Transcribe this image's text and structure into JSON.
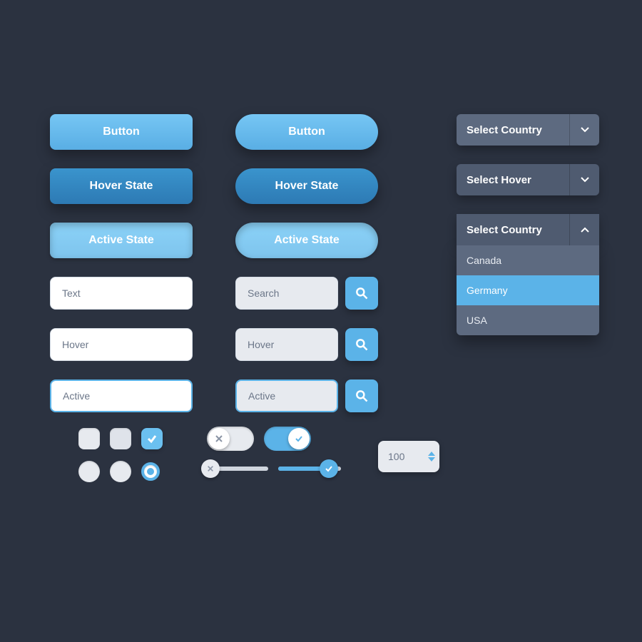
{
  "colors": {
    "accent": "#5bb3e8",
    "accent_dark": "#2d7ab4",
    "panel": "#5d6a80",
    "bg": "#2b3240"
  },
  "buttons": {
    "normal": "Button",
    "hover": "Hover State",
    "active": "Active State"
  },
  "inputs": {
    "text": "Text",
    "hover": "Hover",
    "active": "Active",
    "search": "Search",
    "search_hover": "Hover",
    "search_active": "Active"
  },
  "selects": {
    "default_label": "Select Country",
    "hover_label": "Select Hover",
    "open_label": "Select Country",
    "options": [
      "Canada",
      "Germany",
      "USA"
    ],
    "selected": "Germany"
  },
  "spinner": {
    "value": "100"
  },
  "icons": {
    "search": "search-icon",
    "chevron_down": "chevron-down-icon",
    "chevron_up": "chevron-up-icon",
    "check": "check-icon",
    "x": "x-icon"
  }
}
